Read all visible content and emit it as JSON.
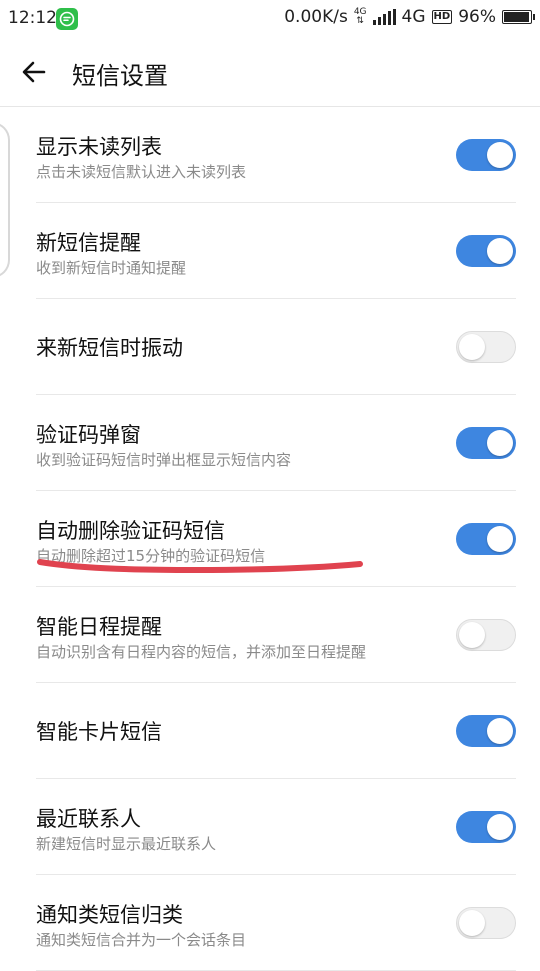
{
  "status_bar": {
    "time": "12:12",
    "net_speed": "0.00K/s",
    "network_tag_top": "4G",
    "network_tag_bottom": "⇅",
    "network_type": "4G",
    "hd_badge": "HD",
    "battery_percent": "96%",
    "battery_level": 0.96,
    "app_icon": "chat-bubble-icon"
  },
  "header": {
    "back_icon": "arrow-left-icon",
    "title": "短信设置"
  },
  "settings": [
    {
      "title": "显示未读列表",
      "subtitle": "点击未读短信默认进入未读列表",
      "on": true
    },
    {
      "title": "新短信提醒",
      "subtitle": "收到新短信时通知提醒",
      "on": true
    },
    {
      "title": "来新短信时振动",
      "subtitle": "",
      "on": false
    },
    {
      "title": "验证码弹窗",
      "subtitle": "收到验证码短信时弹出框显示短信内容",
      "on": true
    },
    {
      "title": "自动删除验证码短信",
      "subtitle": "自动删除超过15分钟的验证码短信",
      "on": true
    },
    {
      "title": "智能日程提醒",
      "subtitle": "自动识别含有日程内容的短信，并添加至日程提醒",
      "on": false
    },
    {
      "title": "智能卡片短信",
      "subtitle": "",
      "on": true
    },
    {
      "title": "最近联系人",
      "subtitle": "新建短信时显示最近联系人",
      "on": true
    },
    {
      "title": "通知类短信归类",
      "subtitle": "通知类短信合并为一个会话条目",
      "on": false
    }
  ],
  "colors": {
    "toggle_on": "#3e86e0",
    "toggle_off": "#f0f0f0",
    "annotation": "#e0434f"
  }
}
